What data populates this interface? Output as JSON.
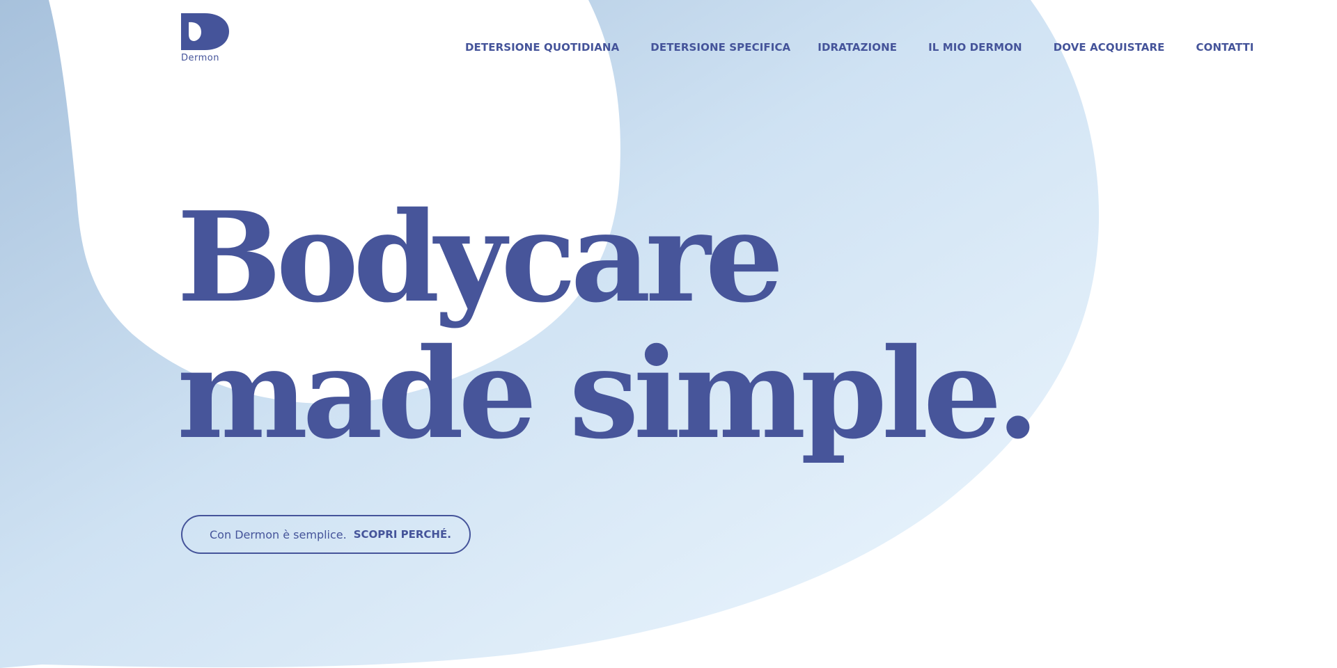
{
  "brand": {
    "name": "Dermon",
    "primary_color": "#45549a",
    "gradient_dark": "#a9c4de",
    "gradient_light": "#eaf5fd"
  },
  "nav": {
    "items": [
      {
        "label": "DETERSIONE QUOTIDIANA"
      },
      {
        "label": "DETERSIONE SPECIFICA"
      },
      {
        "label": "IDRATAZIONE"
      },
      {
        "label": "IL MIO DERMON"
      },
      {
        "label": "DOVE ACQUISTARE"
      },
      {
        "label": "CONTATTI"
      }
    ]
  },
  "hero": {
    "line1": "Bodycare",
    "line2": "made simple."
  },
  "cta": {
    "text": "Con Dermon è semplice.",
    "action": "SCOPRI PERCHÉ."
  }
}
